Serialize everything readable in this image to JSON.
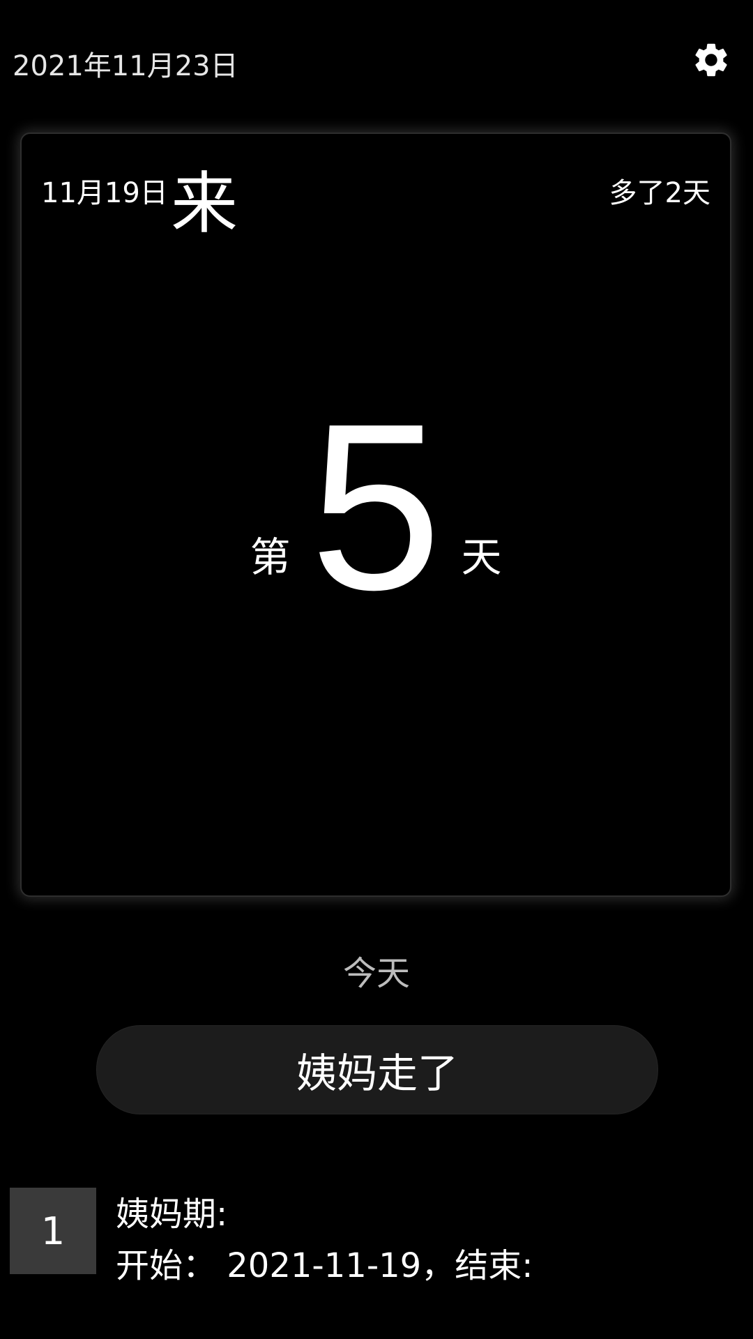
{
  "header": {
    "date": "2021年11月23日",
    "settings_icon": "gear-icon"
  },
  "card": {
    "start_date": "11月19日",
    "status_char": "来",
    "extra": "多了2天",
    "day_prefix": "第",
    "day_number": "5",
    "day_suffix": "天"
  },
  "today_label": "今天",
  "leave_button": {
    "label": "姨妈走了"
  },
  "records": [
    {
      "index": "1",
      "title": "姨妈期:",
      "detail": "开始： 2021-11-19，结束:"
    }
  ]
}
